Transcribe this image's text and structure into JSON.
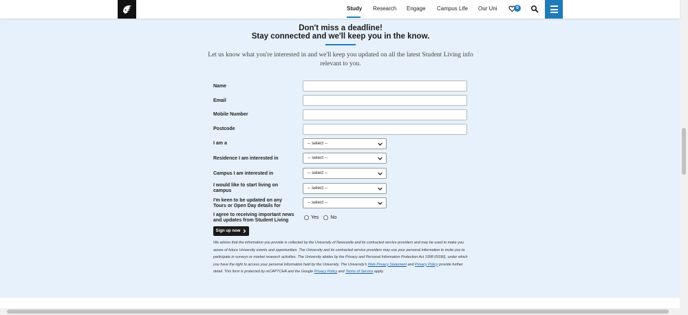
{
  "header": {
    "nav": [
      "Study",
      "Research",
      "Engage",
      "Campus Life",
      "Our Uni"
    ],
    "active": "Study",
    "favourites_count": "0"
  },
  "hero": {
    "title_line1": "Don't miss a deadline!",
    "title_line2": "Stay connected and we'll keep you in the know.",
    "intro": "Let us know what you're interested in and we'll keep you updated on all the latest Student Living info relevant to you."
  },
  "form": {
    "name_label": "Name",
    "email_label": "Email",
    "mobile_label": "Mobile Number",
    "postcode_label": "Postcode",
    "iam_label": "I am a",
    "residence_label": "Residence I am interested in",
    "campus_label": "Campus I am interested in",
    "start_label": "I would like to start living on campus",
    "tours_label": "I'm keen to be updated on any Tours or Open Day details for",
    "agree_label": "I agree to receiving important news and updates from Student Living",
    "select_placeholder": "-- select --",
    "yes": "Yes",
    "no": "No",
    "submit": "Sign up now"
  },
  "disclaimer": {
    "p1": "We advise that the information you provide is collected by the University of Newcastle and its contracted service providers and may be used to make you aware of future University events and opportunities. The University and its contracted service providers may use your personal information to invite you to participate in surveys or market research activities. The University abides by the Privacy and Personal Information Protection Act 1998 (NSW), under which you have the right to access your personal information held by the University. The University's ",
    "link1": "Web Privacy Statement",
    "and1": " and ",
    "link2": "Privacy Policy",
    "p2": " provide further detail. This form is protected by reCAPTCHA and the Google ",
    "link3": "Privacy Policy",
    "and2": " and ",
    "link4": "Terms of Service",
    "p3": " apply."
  },
  "colors": {
    "accent": "#1f7ab8",
    "background": "#e6f1fb"
  }
}
